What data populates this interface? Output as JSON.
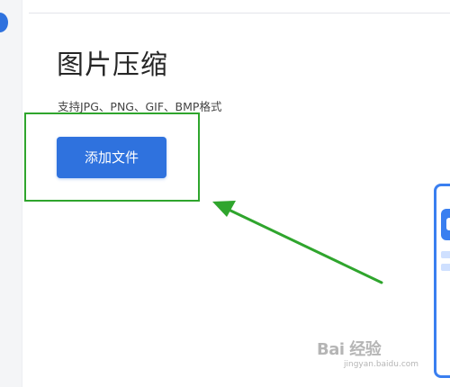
{
  "page": {
    "title": "图片压缩",
    "subtitle": "支持JPG、PNG、GIF、BMP格式"
  },
  "upload": {
    "add_file_label": "添加文件"
  },
  "annotation": {
    "highlight_color": "#2fa52d",
    "arrow_color": "#2fa52d"
  },
  "watermark": {
    "logo_text": "Bai 经验",
    "url": "jingyan.baidu.com"
  },
  "colors": {
    "primary": "#2f72de",
    "rail_bg": "#f4f5f7"
  }
}
